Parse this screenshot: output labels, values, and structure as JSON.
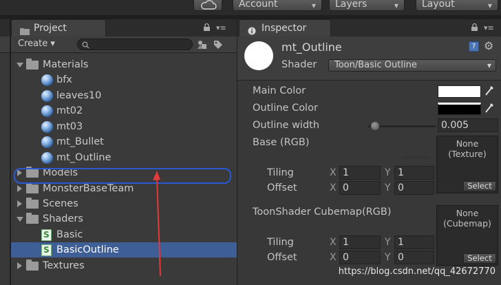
{
  "toolbar": {
    "account_label": "Account",
    "layers_label": "Layers",
    "layout_label": "Layout"
  },
  "project": {
    "tab_label": "Project",
    "create_label": "Create ▾",
    "search_placeholder": "",
    "tree": [
      {
        "label": "Materials",
        "type": "folder",
        "state": "open"
      },
      {
        "label": "bfx",
        "type": "material"
      },
      {
        "label": "leaves10",
        "type": "material"
      },
      {
        "label": "mt02",
        "type": "material"
      },
      {
        "label": "mt03",
        "type": "material"
      },
      {
        "label": "mt_Bullet",
        "type": "material"
      },
      {
        "label": "mt_Outline",
        "type": "material",
        "highlighted": true
      },
      {
        "label": "Models",
        "type": "folder",
        "state": "closed"
      },
      {
        "label": "MonsterBaseTeam",
        "type": "folder",
        "state": "closed"
      },
      {
        "label": "Scenes",
        "type": "folder",
        "state": "closed"
      },
      {
        "label": "Shaders",
        "type": "folder",
        "state": "open"
      },
      {
        "label": "Basic",
        "type": "shader"
      },
      {
        "label": "BasicOutline",
        "type": "shader",
        "selected": true
      },
      {
        "label": "Textures",
        "type": "folder",
        "state": "closed"
      }
    ]
  },
  "inspector": {
    "tab_label": "Inspector",
    "material_name": "mt_Outline",
    "shader_label": "Shader",
    "shader_value": "Toon/Basic Outline",
    "main_color_label": "Main Color",
    "main_color": "#ffffff",
    "outline_color_label": "Outline Color",
    "outline_color": "#000000",
    "outline_width_label": "Outline width",
    "outline_width_value": "0.005",
    "base_label": "Base (RGB)",
    "base_texture": "None\n(Texture)",
    "cubemap_label": "ToonShader Cubemap(RGB)",
    "cubemap_texture": "None\n(Cubemap)",
    "select_label": "Select",
    "tiling_label": "Tiling",
    "offset_label": "Offset",
    "x_label": "X",
    "y_label": "Y",
    "base_tiling": {
      "x": "1",
      "y": "1"
    },
    "base_offset": {
      "x": "0",
      "y": "0"
    },
    "cube_tiling": {
      "x": "1",
      "y": "1"
    },
    "cube_offset": {
      "x": "0",
      "y": "0"
    }
  },
  "watermark": "https://blog.csdn.net/qq_42672770",
  "colors": {
    "selection": "#3e5f96",
    "highlight_ring": "#2b59d6",
    "annotation_arrow": "#e23b3b"
  }
}
